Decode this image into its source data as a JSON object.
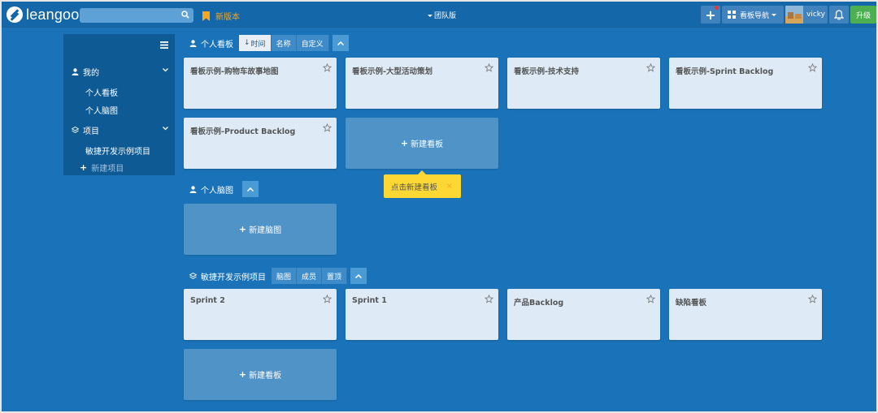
{
  "topbar": {
    "logo": "leangoo",
    "search_placeholder": "",
    "new_version": "新版本",
    "team_edition": "团队版",
    "board_nav": "看板导航",
    "username": "vicky",
    "upgrade": "升级"
  },
  "sidebar": {
    "mine": "我的",
    "mine_items": [
      "个人看板",
      "个人脑图"
    ],
    "projects": "项目",
    "project_items": [
      "敏捷开发示例项目"
    ],
    "new_project": "新建项目"
  },
  "personal_boards": {
    "title": "个人看板",
    "tabs": [
      "时间",
      "名称",
      "自定义"
    ],
    "boards": [
      "看板示例-购物车故事地图",
      "看板示例-大型活动策划",
      "看板示例-技术支持",
      "看板示例-Sprint Backlog",
      "看板示例-Product Backlog"
    ],
    "new_board": "新建看板"
  },
  "tooltip": {
    "text": "点击新建看板",
    "close": "×"
  },
  "personal_mindmaps": {
    "title": "个人脑图",
    "new_mindmap": "新建脑图"
  },
  "project": {
    "title": "敏捷开发示例项目",
    "tabs": [
      "脑图",
      "成员",
      "置顶"
    ],
    "boards": [
      "Sprint 2",
      "Sprint 1",
      "产品Backlog",
      "缺陷看板"
    ],
    "new_board": "新建看板"
  },
  "colors": {
    "background": "#1a73b8",
    "topbar": "#1467a8",
    "card": "#deebf7",
    "accent_orange": "#f5a623",
    "upgrade_green": "#4caf50",
    "tooltip_yellow": "#fdd835"
  }
}
